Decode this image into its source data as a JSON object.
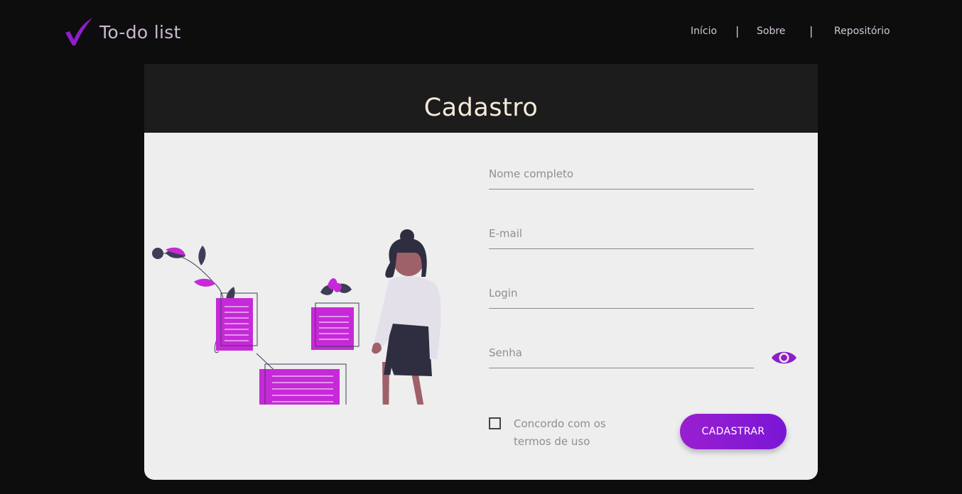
{
  "app": {
    "title": "To-do list",
    "icon": "check-icon",
    "accent_color": "#8e1ec9"
  },
  "nav": {
    "items": [
      {
        "label": "Início"
      },
      {
        "label": "Sobre"
      },
      {
        "label": "Repositório"
      }
    ],
    "separator": "|"
  },
  "card": {
    "title": "Cadastro"
  },
  "form": {
    "name_placeholder": "Nome completo",
    "email_placeholder": "E-mail",
    "login_placeholder": "Login",
    "password_placeholder": "Senha",
    "toggle_password_icon": "eye-icon",
    "terms_label": "Concordo com os termos de uso",
    "terms_checked": false,
    "submit_label": "CADASTRAR"
  },
  "illustration": {
    "icon": "person-with-documents-illustration"
  }
}
